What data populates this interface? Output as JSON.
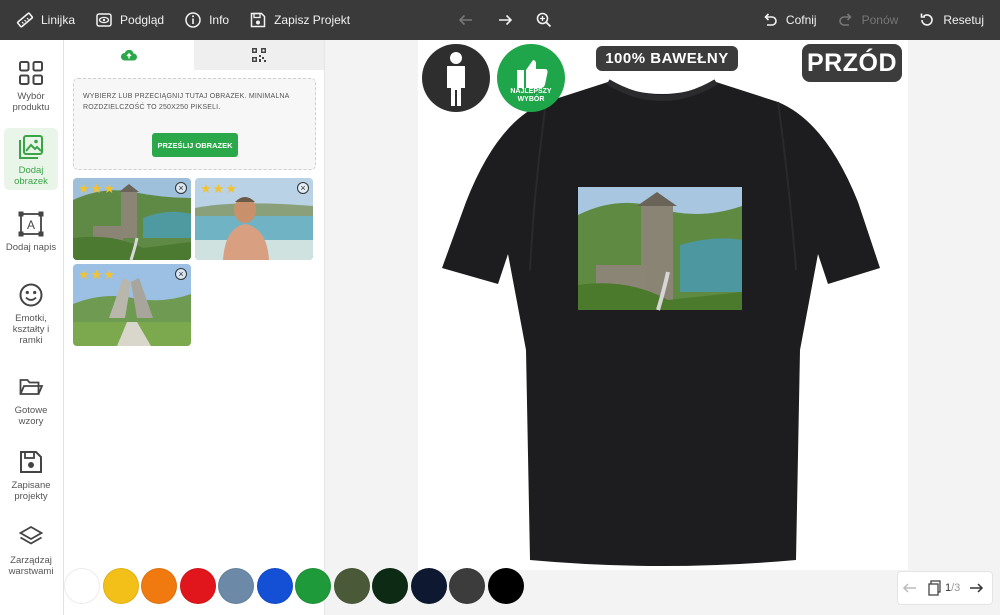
{
  "toolbar": {
    "ruler": "Linijka",
    "preview": "Podgląd",
    "info": "Info",
    "save": "Zapisz Projekt",
    "undo": "Cofnij",
    "redo": "Ponów",
    "reset": "Resetuj"
  },
  "sidebar": {
    "items": [
      {
        "label": "Wybór produktu"
      },
      {
        "label": "Dodaj obrazek"
      },
      {
        "label": "Dodaj napis"
      },
      {
        "label": "Emotki, kształty i ramki"
      },
      {
        "label": "Gotowe wzory"
      },
      {
        "label": "Zapisane projekty"
      },
      {
        "label": "Zarządzaj warstwami"
      }
    ]
  },
  "upload": {
    "instructions": "WYBIERZ LUB PRZECIĄGNIJ TUTAJ OBRAZEK. MINIMALNA ROZDZIELCZOŚĆ TO 250X250 PIKSELI.",
    "button": "PRZEŚLIJ OBRAZEK"
  },
  "stage": {
    "best_choice": "NAJLEPSZY WYBÓR",
    "cotton": "100% BAWEŁNY",
    "side": "PRZÓD"
  },
  "colors": [
    "#ffffff",
    "#f2c018",
    "#f07a10",
    "#e0161c",
    "#6c8aa8",
    "#1450d6",
    "#1f9a3a",
    "#4a5a38",
    "#0d2a14",
    "#0e1830",
    "#3c3c3c",
    "#000000"
  ],
  "pager": {
    "current": "1",
    "total": "/3"
  }
}
